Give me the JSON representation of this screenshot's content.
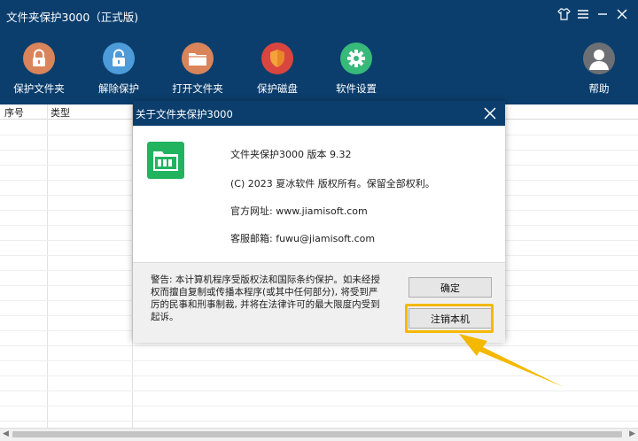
{
  "app": {
    "title": "文件夹保护3000（正式版)"
  },
  "toolbar": {
    "items": [
      {
        "label": "保护文件夹",
        "icon": "lock-icon",
        "color": "#d9845a"
      },
      {
        "label": "解除保护",
        "icon": "unlock-icon",
        "color": "#4d9bd9"
      },
      {
        "label": "打开文件夹",
        "icon": "folder-icon",
        "color": "#d9845a"
      },
      {
        "label": "保护磁盘",
        "icon": "shield-icon",
        "color": "#d9453f"
      },
      {
        "label": "软件设置",
        "icon": "gear-icon",
        "color": "#37b97a"
      }
    ],
    "help_label": "帮助"
  },
  "table": {
    "columns": [
      "序号",
      "类型"
    ]
  },
  "dialog": {
    "title": "关于文件夹保护3000",
    "version_line": "文件夹保护3000 版本 9.32",
    "copyright_line": "(C) 2023 夏冰软件 版权所有。保留全部权利。",
    "website_line": "官方网址: www.jiamisoft.com",
    "email_line": "客服邮箱: fuwu@jiamisoft.com",
    "warning_text": "警告: 本计算机程序受版权法和国际条约保护。如未经授权而擅自复制或传播本程序(或其中任何部分), 将受到严厉的民事和刑事制裁, 并将在法律许可的最大限度内受到起诉。",
    "ok_label": "确定",
    "unregister_label": "注销本机"
  },
  "colors": {
    "titlebar": "#0b3e6d",
    "highlight": "#f5b800",
    "app_icon": "#22b35e"
  }
}
